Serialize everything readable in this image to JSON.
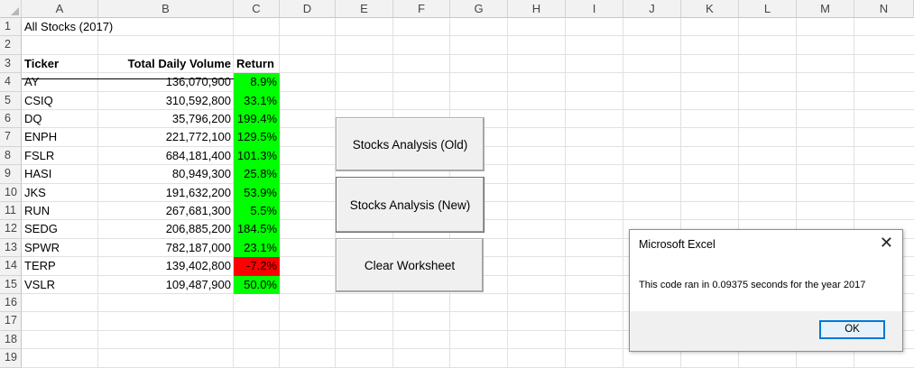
{
  "columns": [
    "A",
    "B",
    "C",
    "D",
    "E",
    "F",
    "G",
    "H",
    "I",
    "J",
    "K",
    "L",
    "M",
    "N"
  ],
  "rows": [
    "1",
    "2",
    "3",
    "4",
    "5",
    "6",
    "7",
    "8",
    "9",
    "10",
    "11",
    "12",
    "13",
    "14",
    "15",
    "16",
    "17",
    "18",
    "19"
  ],
  "title": "All Stocks (2017)",
  "headers": {
    "ticker": "Ticker",
    "volume": "Total Daily Volume",
    "return": "Return"
  },
  "stocks": [
    {
      "ticker": "AY",
      "volume": "136,070,900",
      "return": "8.9%",
      "positive": true
    },
    {
      "ticker": "CSIQ",
      "volume": "310,592,800",
      "return": "33.1%",
      "positive": true
    },
    {
      "ticker": "DQ",
      "volume": "35,796,200",
      "return": "199.4%",
      "positive": true
    },
    {
      "ticker": "ENPH",
      "volume": "221,772,100",
      "return": "129.5%",
      "positive": true
    },
    {
      "ticker": "FSLR",
      "volume": "684,181,400",
      "return": "101.3%",
      "positive": true
    },
    {
      "ticker": "HASI",
      "volume": "80,949,300",
      "return": "25.8%",
      "positive": true
    },
    {
      "ticker": "JKS",
      "volume": "191,632,200",
      "return": "53.9%",
      "positive": true
    },
    {
      "ticker": "RUN",
      "volume": "267,681,300",
      "return": "5.5%",
      "positive": true
    },
    {
      "ticker": "SEDG",
      "volume": "206,885,200",
      "return": "184.5%",
      "positive": true
    },
    {
      "ticker": "SPWR",
      "volume": "782,187,000",
      "return": "23.1%",
      "positive": true
    },
    {
      "ticker": "TERP",
      "volume": "139,402,800",
      "return": "-7.2%",
      "positive": false
    },
    {
      "ticker": "VSLR",
      "volume": "109,487,900",
      "return": "50.0%",
      "positive": true
    }
  ],
  "colors": {
    "positive": "#00ff00",
    "negative": "#ff0000"
  },
  "buttons": {
    "old": "Stocks Analysis (Old)",
    "new": "Stocks Analysis (New)",
    "clear": "Clear Worksheet"
  },
  "dialog": {
    "title": "Microsoft Excel",
    "close_icon": "close-icon",
    "message": "This code ran in 0.09375 seconds for the year 2017",
    "ok": "OK"
  }
}
